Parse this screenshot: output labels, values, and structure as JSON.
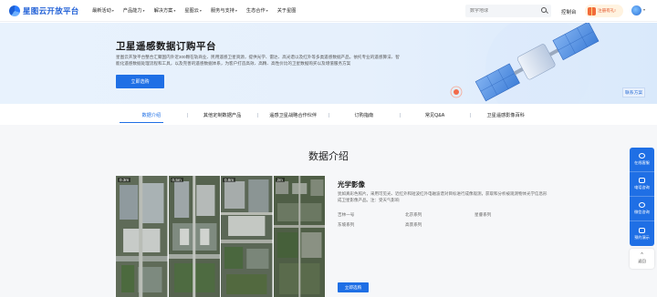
{
  "nav": {
    "logo": "星图云开放平台",
    "menu": [
      {
        "label": "最新活动",
        "dropdown": true
      },
      {
        "label": "产品能力",
        "dropdown": true
      },
      {
        "label": "解决方案",
        "dropdown": true
      },
      {
        "label": "星图云",
        "dropdown": true
      },
      {
        "label": "服务与支持",
        "dropdown": true
      },
      {
        "label": "生态合作",
        "dropdown": true
      },
      {
        "label": "关于星图",
        "dropdown": false
      }
    ],
    "search_placeholder": "数字地球",
    "console": "控制台",
    "promo": "注册有礼!"
  },
  "hero": {
    "title": "卫星遥感数据订购平台",
    "description": "星图云开放平台整合汇聚国内外近300颗在轨商业、民用遥感卫星资源，提供光学、雷达、高光谱以及红外等多类遥感数据产品，依托专业的遥感算法、智能化遥感数据处理流程和工具，以及完善的遥感数据体系，为客户打造高效、高精、高性价比的卫星数据购买以及增值服务方案",
    "button": "立即选购",
    "more": "联系方案"
  },
  "tabs": [
    {
      "label": "数据介绍",
      "active": true
    },
    {
      "label": "其他定制数据产品",
      "active": false
    },
    {
      "label": "遥感卫星战略合作伙伴",
      "active": false
    },
    {
      "label": "订购指南",
      "active": false
    },
    {
      "label": "常见Q&A",
      "active": false
    },
    {
      "label": "卫星遥感影像百科",
      "active": false
    }
  ],
  "section": {
    "title": "数据介绍",
    "images": [
      {
        "label": "0.3m"
      },
      {
        "label": "0.5m"
      },
      {
        "label": "0.8m"
      },
      {
        "label": "2m"
      }
    ],
    "optical": {
      "title": "光学影像",
      "description": "犹如真彩色照片，采用可见光、近红外和短波红外电磁波谱对目标进行成像观测，获取和分析被观测物体光学信息形成卫星影像产品。注：受天气影响",
      "series": [
        "吉林一号",
        "北京系列",
        "星睿系列",
        "东坡系列",
        "高景系列"
      ],
      "button": "立即选购"
    }
  },
  "float": {
    "items": [
      {
        "label": "在线客服",
        "icon": "headset-icon"
      },
      {
        "label": "电话咨询",
        "icon": "phone-icon"
      },
      {
        "label": "微信咨询",
        "icon": "wechat-icon"
      },
      {
        "label": "预约演示",
        "icon": "demo-icon"
      }
    ],
    "back_top": "返回"
  },
  "colors": {
    "accent": "#1f6fe5",
    "hero_bg": "#e8f2fd",
    "section_bg": "#f6f7f9"
  }
}
